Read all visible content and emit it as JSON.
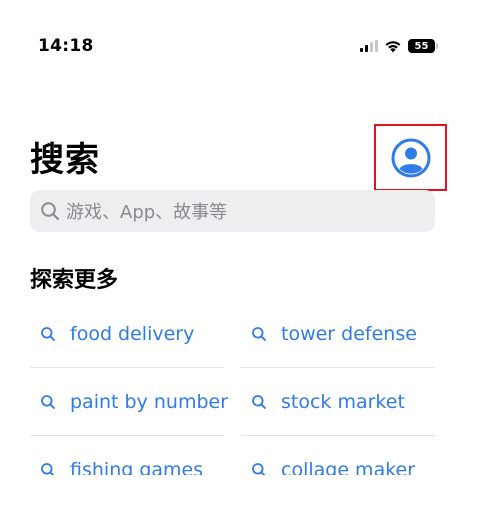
{
  "status_bar": {
    "time": "14:18",
    "battery": "55",
    "icons": [
      "cellular-signal-icon",
      "wifi-icon",
      "battery-icon"
    ]
  },
  "header": {
    "title": "搜索",
    "account_icon": "person-circle-icon"
  },
  "search": {
    "placeholder": "游戏、App、故事等"
  },
  "explore": {
    "title": "探索更多",
    "items": [
      {
        "label": "food delivery"
      },
      {
        "label": "tower defense"
      },
      {
        "label": "paint by number"
      },
      {
        "label": "stock market"
      },
      {
        "label": "fishing games"
      },
      {
        "label": "collage maker"
      }
    ]
  },
  "colors": {
    "accent": "#2f7ce6",
    "highlight_box": "#e0151b",
    "search_bg": "#eeeef0",
    "placeholder": "#8a8a8e"
  }
}
